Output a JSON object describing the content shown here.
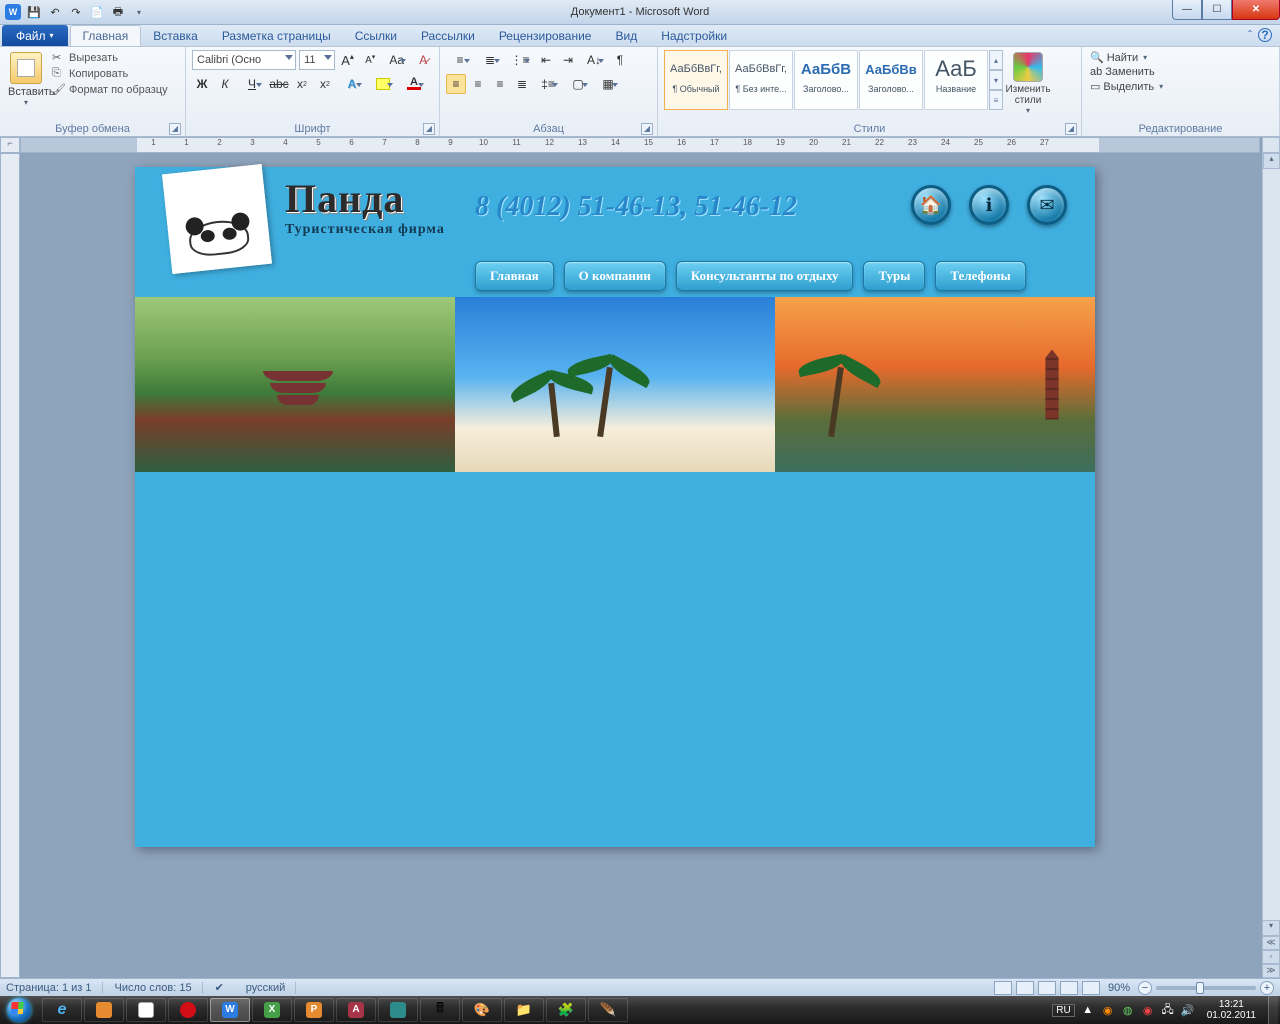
{
  "titlebar": {
    "title": "Документ1 - Microsoft Word"
  },
  "tabs": {
    "file": "Файл",
    "items": [
      "Главная",
      "Вставка",
      "Разметка страницы",
      "Ссылки",
      "Рассылки",
      "Рецензирование",
      "Вид",
      "Надстройки"
    ],
    "active": "Главная"
  },
  "ribbon": {
    "clipboard": {
      "paste": "Вставить",
      "cut": "Вырезать",
      "copy": "Копировать",
      "format_painter": "Формат по образцу",
      "label": "Буфер обмена"
    },
    "font": {
      "name": "Calibri (Осно",
      "size": "11",
      "label": "Шрифт"
    },
    "paragraph": {
      "label": "Абзац"
    },
    "styles": {
      "label": "Стили",
      "change": "Изменить стили",
      "tiles": [
        {
          "sample": "АаБбВвГг,",
          "name": "¶ Обычный",
          "color": "#333",
          "size": "11px"
        },
        {
          "sample": "АаБбВвГг,",
          "name": "¶ Без инте...",
          "color": "#333",
          "size": "11px"
        },
        {
          "sample": "АаБбВ",
          "name": "Заголово...",
          "color": "#2b6cb3",
          "size": "15px",
          "bold": true
        },
        {
          "sample": "АаБбВв",
          "name": "Заголово...",
          "color": "#2b6cb3",
          "size": "13px",
          "bold": true
        },
        {
          "sample": "АаБ",
          "name": "Название",
          "color": "#333",
          "size": "22px"
        }
      ]
    },
    "editing": {
      "find": "Найти",
      "replace": "Заменить",
      "select": "Выделить",
      "label": "Редактирование"
    }
  },
  "document": {
    "brand": "Панда",
    "tagline": "Туристическая  фирма",
    "phone": "8 (4012) 51-46-13, 51-46-12",
    "nav": [
      "Главная",
      "О компании",
      "Консультанты по отдыху",
      "Туры",
      "Телефоны"
    ]
  },
  "statusbar": {
    "page": "Страница: 1 из 1",
    "words": "Число слов: 15",
    "lang": "русский",
    "zoom": "90%"
  },
  "taskbar": {
    "lang": "RU",
    "time": "13:21",
    "date": "01.02.2011"
  }
}
